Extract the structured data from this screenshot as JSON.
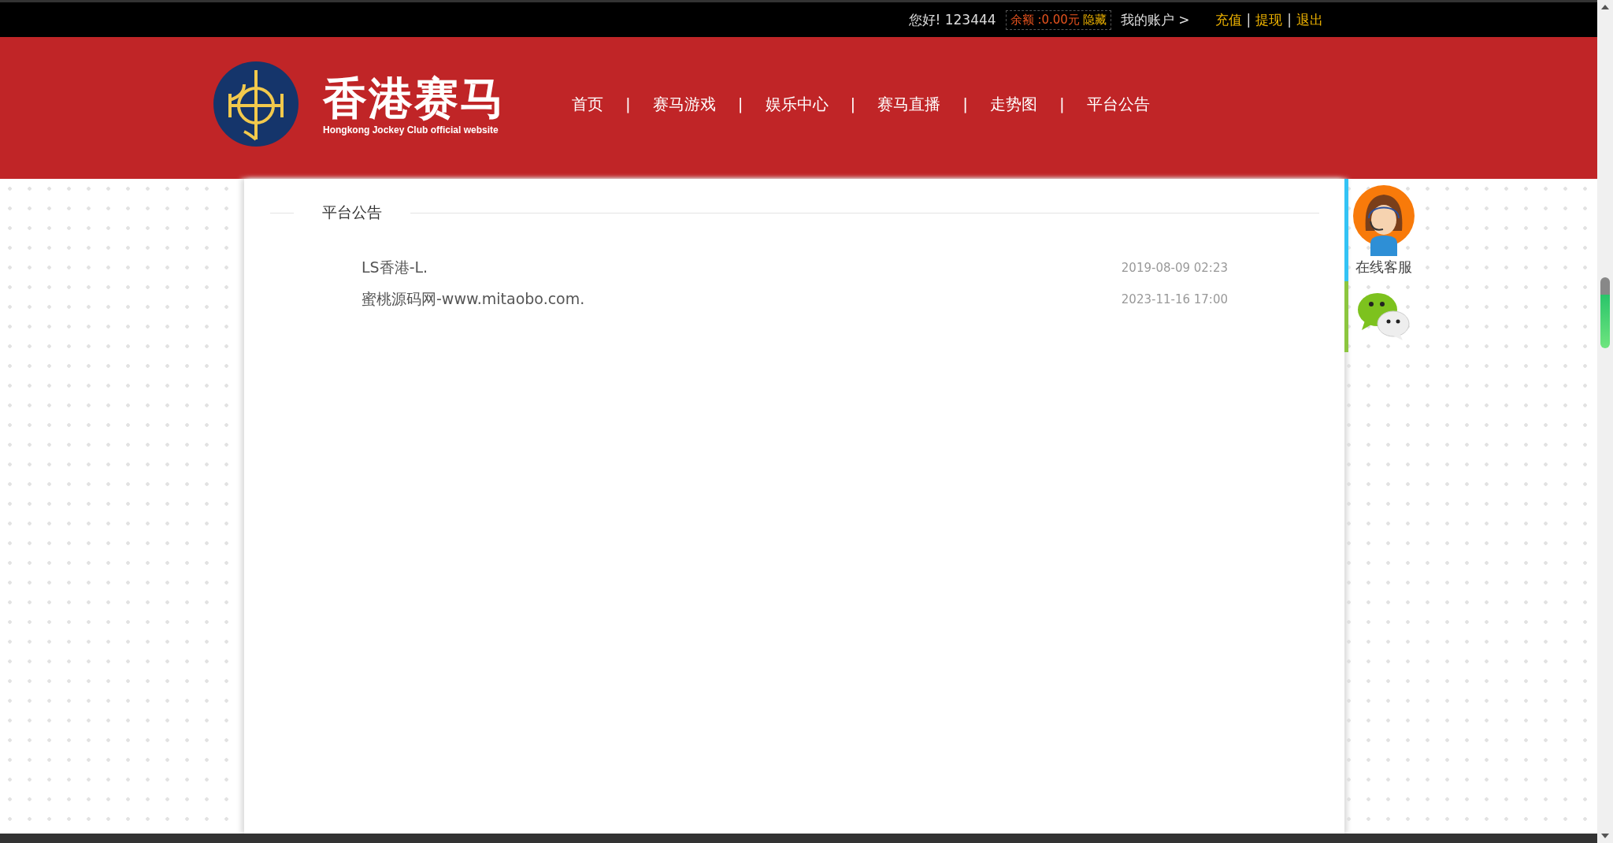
{
  "top_bar": {
    "greeting": "您好! 123444",
    "balance": {
      "label": "余额 :0.00元",
      "toggle": "隐藏"
    },
    "account_link": "我的账户 >",
    "actions": [
      {
        "label": "充值"
      },
      {
        "label": "提现"
      },
      {
        "label": "退出"
      }
    ],
    "separator": "|"
  },
  "header": {
    "logo_title": "香港赛马",
    "logo_subtitle": "Hongkong Jockey Club official website",
    "nav": [
      {
        "label": "首页"
      },
      {
        "label": "赛马游戏"
      },
      {
        "label": "娱乐中心"
      },
      {
        "label": "赛马直播"
      },
      {
        "label": "走势图"
      },
      {
        "label": "平台公告"
      }
    ],
    "nav_separator": "|"
  },
  "section": {
    "title": "平台公告",
    "notices": [
      {
        "title": "LS香港-L.",
        "date": "2019-08-09 02:23"
      },
      {
        "title": "蜜桃源码网-www.mitaobo.com.",
        "date": "2023-11-16 17:00"
      }
    ]
  },
  "side_widget": {
    "items": [
      {
        "kind": "service",
        "label": "在线客服",
        "color": "#33c3f5"
      },
      {
        "kind": "wechat",
        "color": "#8cc63f"
      }
    ]
  }
}
